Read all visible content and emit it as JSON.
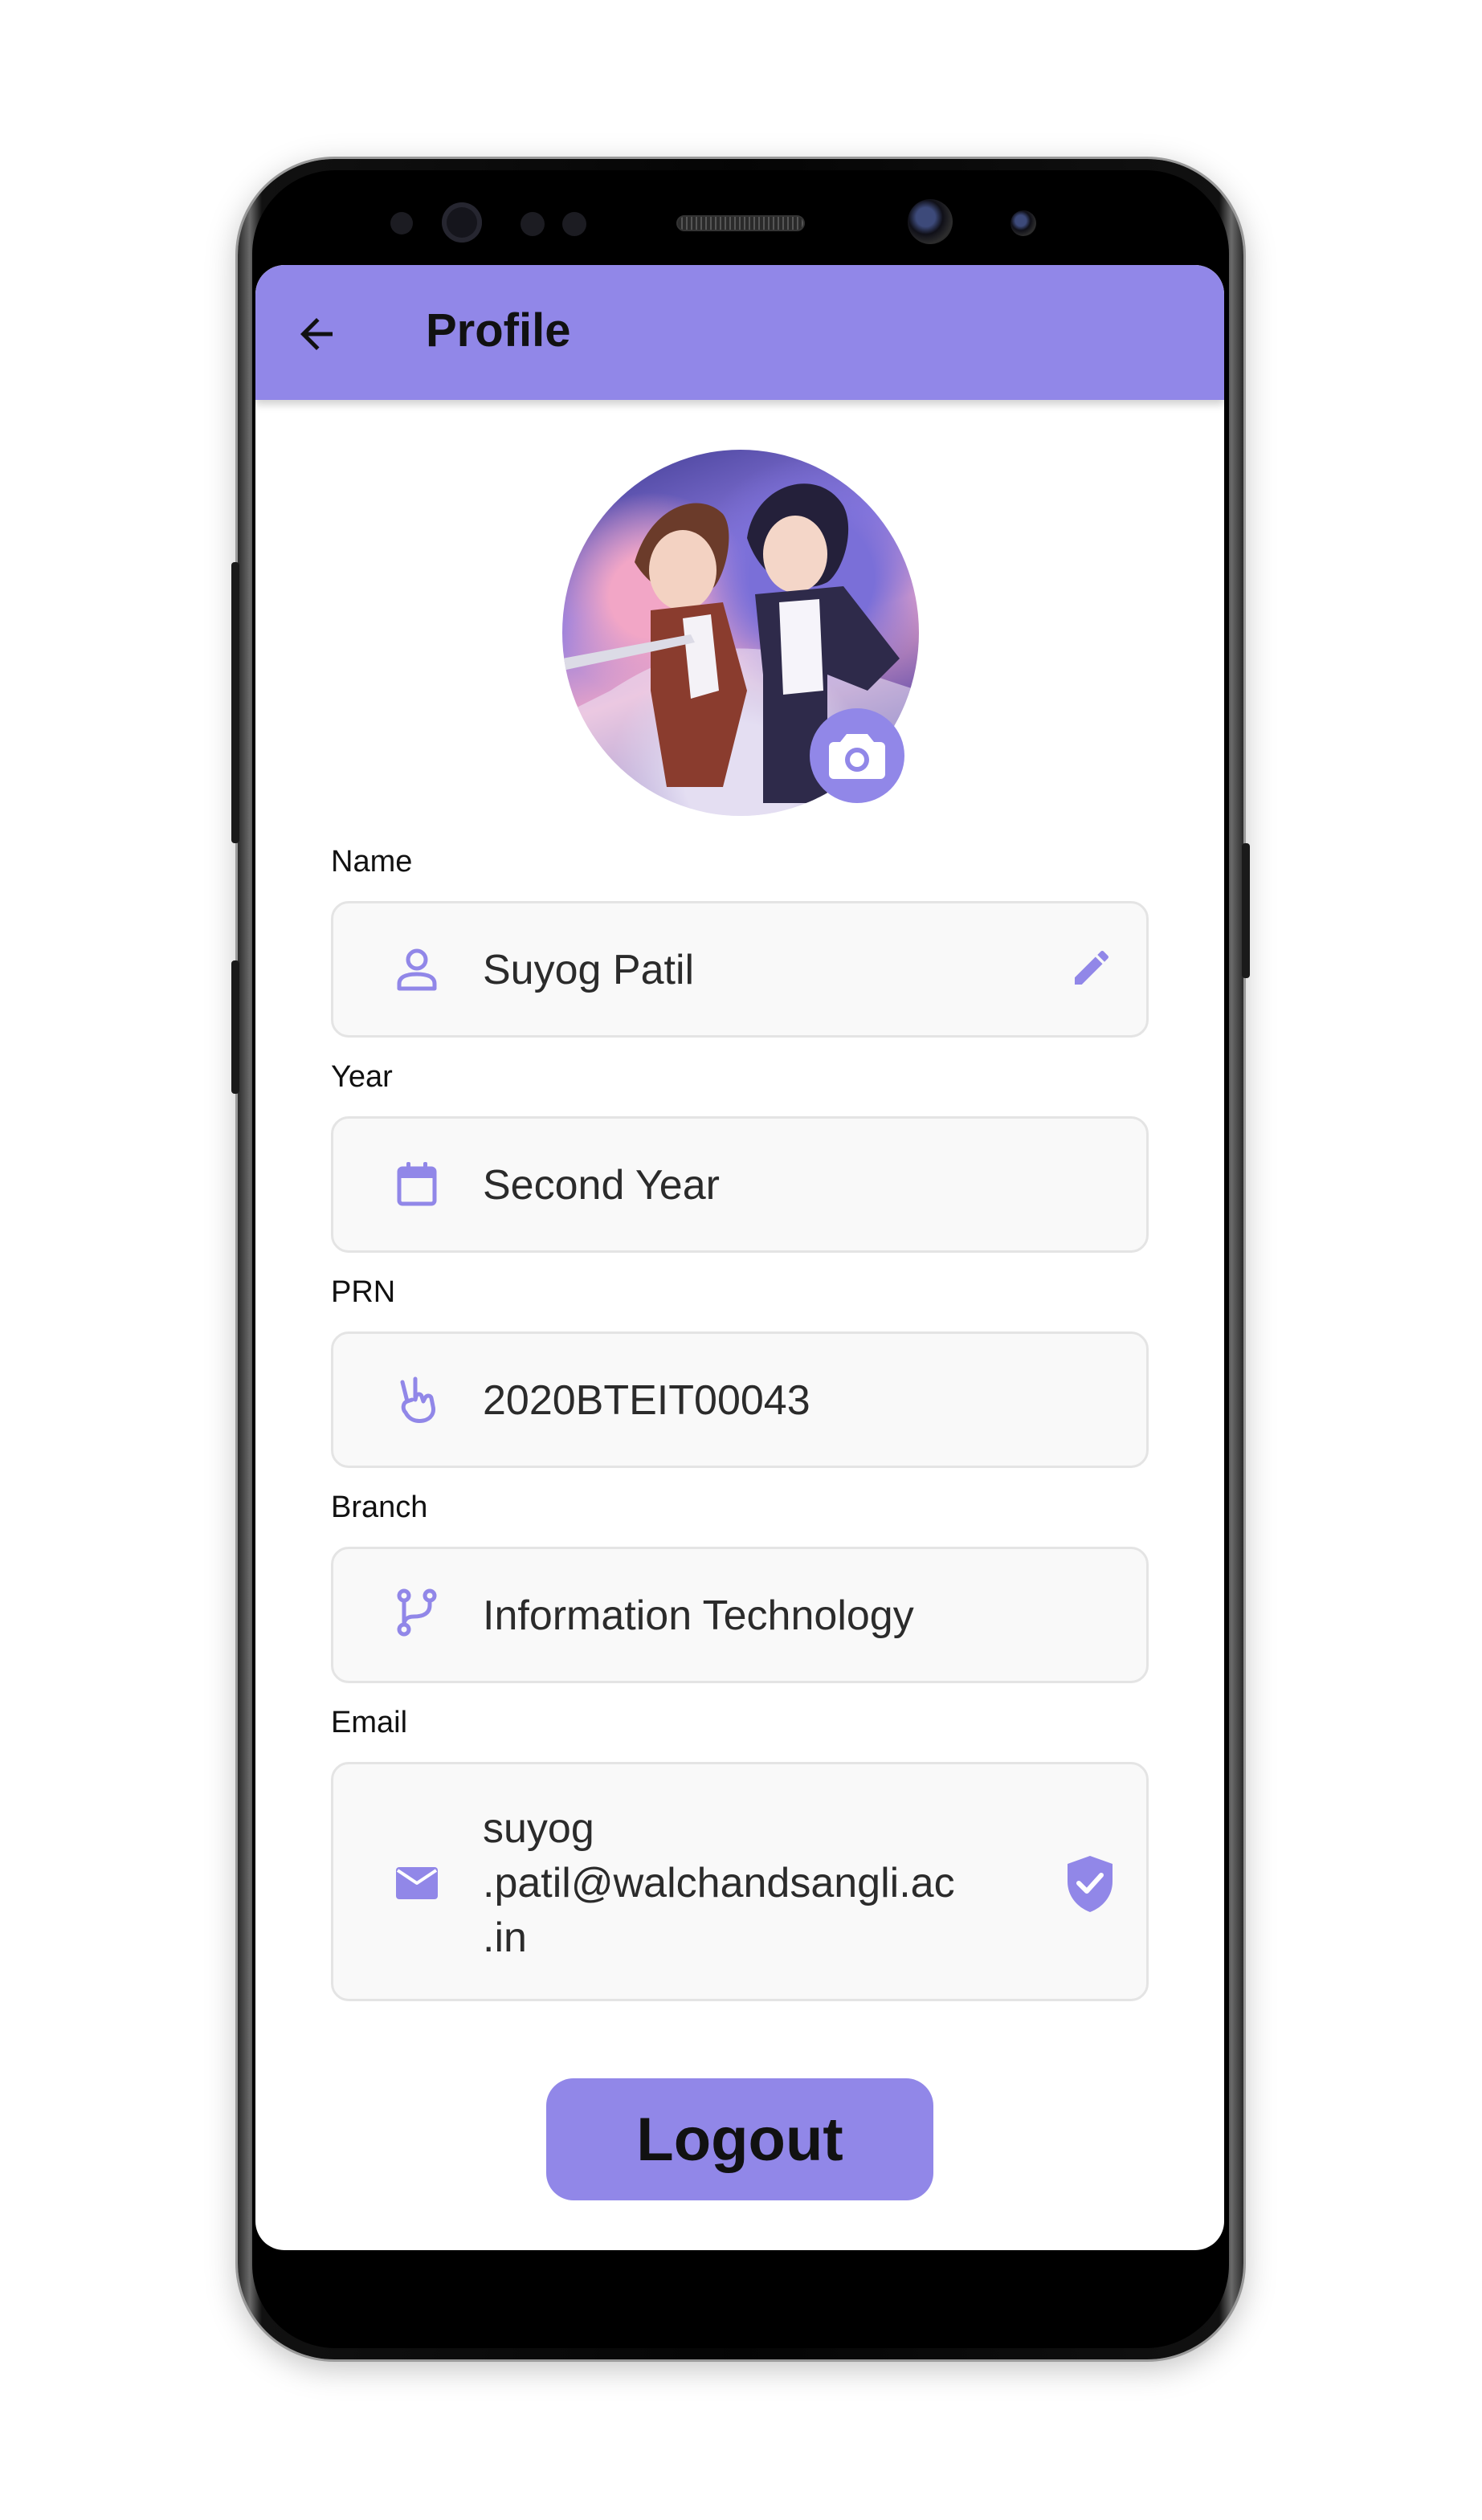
{
  "appbar": {
    "title": "Profile"
  },
  "profile": {
    "name_label": "Name",
    "name_value": "Suyog Patil",
    "year_label": "Year",
    "year_value": "Second Year",
    "prn_label": "PRN",
    "prn_value": "2020BTEIT00043",
    "branch_label": "Branch",
    "branch_value": "Information Technology",
    "email_label": "Email",
    "email_lines": [
      "suyog",
      ".patil@walchandsangli.ac",
      ".in"
    ]
  },
  "actions": {
    "logout_label": "Logout"
  },
  "icons": {
    "back": "arrow-back-icon",
    "camera": "camera-icon",
    "name": "person-icon",
    "edit": "pencil-icon",
    "year": "calendar-icon",
    "prn": "peace-hand-icon",
    "branch": "git-branch-icon",
    "email": "mail-icon",
    "verified": "verified-shield-icon"
  },
  "colors": {
    "accent": "#9187e8",
    "field_bg": "#f9f9f9",
    "field_border": "#e4e4e4"
  }
}
